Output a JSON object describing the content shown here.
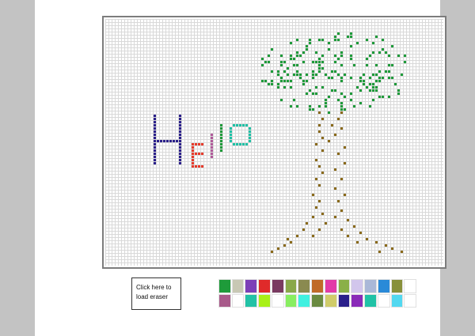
{
  "eraser": {
    "line1": "Click here to",
    "line2": "load eraser"
  },
  "palette": {
    "colors": [
      "#1e9b3a",
      "#c8c8b4",
      "#7d3fb8",
      "#e02a2a",
      "#7a3a60",
      "#8aa84a",
      "#8a8a50",
      "#c06a28",
      "#e23aa8",
      "#8ab048",
      "#d2c6ec",
      "#aab8d8",
      "#2a8ad8",
      "#88903a",
      "#ffffff",
      "#a85a8a",
      "#ffffff",
      "#22c2a6",
      "#a8f018",
      "#ffffff",
      "#88ee60",
      "#40f0e0",
      "#6a8a40",
      "#d0cc6a",
      "#2a1f8a",
      "#8a2ab8",
      "#20c2a6",
      "#ffffff",
      "#52d8f0",
      "#ffffff"
    ]
  },
  "drawing": {
    "hello_colors": {
      "H": "#2a1f8a",
      "E": "#e83a2a",
      "L": "#b05a9a",
      "LL": "#1e9b3a",
      "O": "#1ec2a6"
    },
    "tree_colors": {
      "leaves": "#1e9b3a",
      "trunk": "#8a6a1a"
    }
  }
}
